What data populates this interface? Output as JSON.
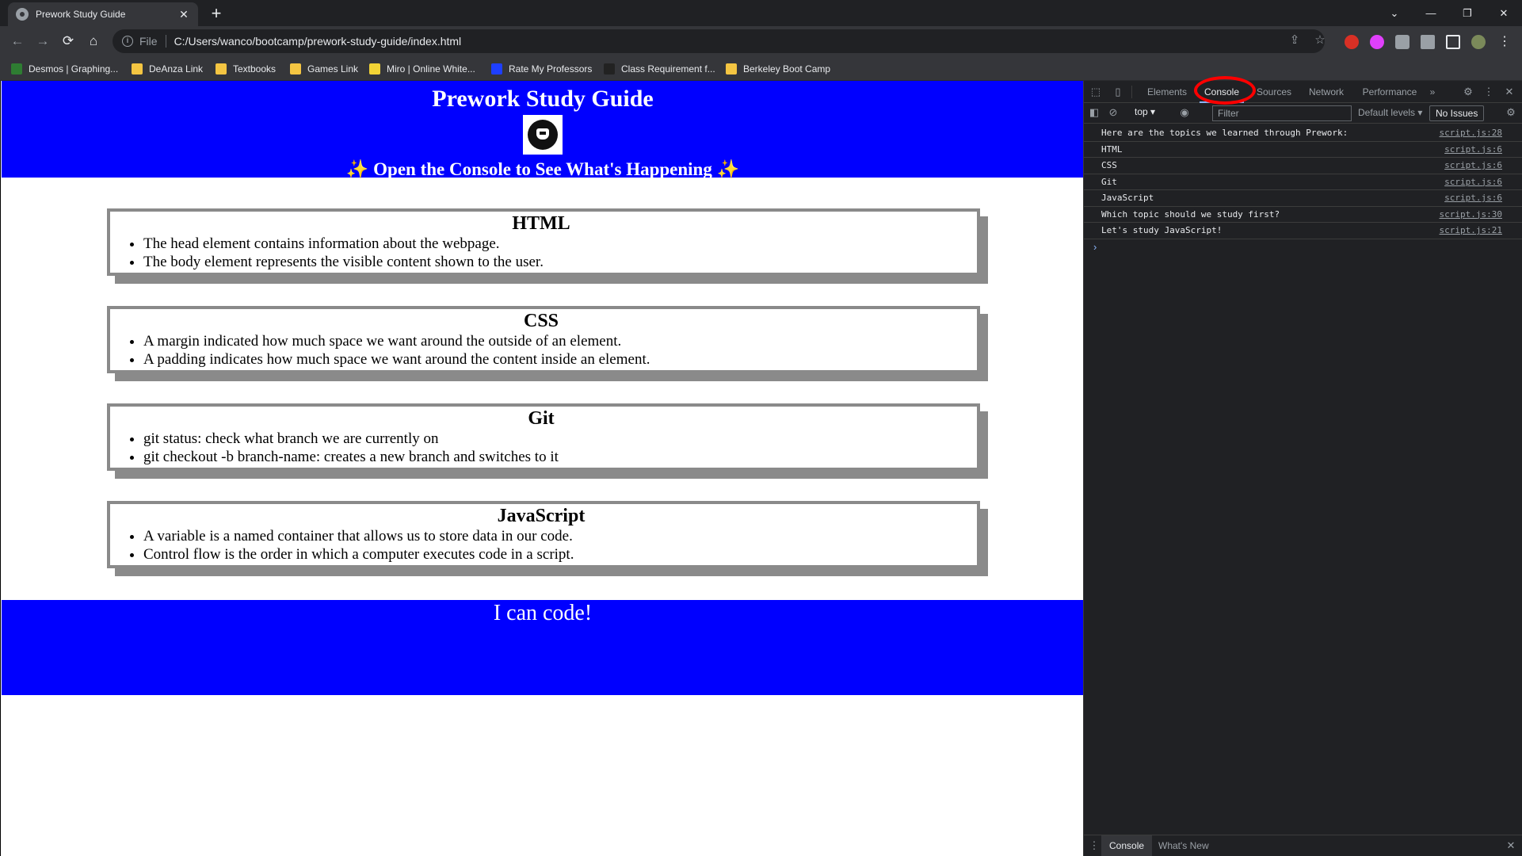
{
  "browser": {
    "tab_title": "Prework Study Guide",
    "tab_close": "✕",
    "new_tab": "+",
    "url_scheme": "File",
    "url": "C:/Users/wanco/bootcamp/prework-study-guide/index.html",
    "window_controls": [
      "⌄",
      "—",
      "❐",
      "✕"
    ],
    "bookmarks": [
      {
        "label": "Desmos | Graphing...",
        "color": "#2e7d32"
      },
      {
        "label": "DeAnza Link",
        "color": "#f4c542"
      },
      {
        "label": "Textbooks",
        "color": "#f4c542"
      },
      {
        "label": "Games Link",
        "color": "#f4c542"
      },
      {
        "label": "Miro | Online White...",
        "color": "#f2d335"
      },
      {
        "label": "Rate My Professors",
        "color": "#1e3fff"
      },
      {
        "label": "Class Requirement f...",
        "color": "#222222"
      },
      {
        "label": "Berkeley Boot Camp",
        "color": "#f4c542"
      }
    ]
  },
  "page": {
    "title": "Prework Study Guide",
    "subtitle": "✨ Open the Console to See What's Happening ✨",
    "sections": [
      {
        "heading": "HTML",
        "items": [
          "The head element contains information about the webpage.",
          "The body element represents the visible content shown to the user."
        ]
      },
      {
        "heading": "CSS",
        "items": [
          "A margin indicated how much space we want around the outside of an element.",
          "A padding indicates how much space we want around the content inside an element."
        ]
      },
      {
        "heading": "Git",
        "items": [
          "git status: check what branch we are currently on",
          "git checkout -b branch-name: creates a new branch and switches to it"
        ]
      },
      {
        "heading": "JavaScript",
        "items": [
          "A variable is a named container that allows us to store data in our code.",
          "Control flow is the order in which a computer executes code in a script."
        ]
      }
    ],
    "footer": "I can code!",
    "colors": {
      "accent": "#0000ff",
      "card_border": "#8a8a8a"
    }
  },
  "devtools": {
    "tabs": [
      "Elements",
      "Console",
      "Sources",
      "Network",
      "Performance"
    ],
    "active_tab": "Console",
    "more_tabs": "»",
    "context": "top",
    "filter_placeholder": "Filter",
    "levels": "Default levels ▾",
    "issues": "No Issues",
    "logs": [
      {
        "msg": "Here are the topics we learned through Prework:",
        "src": "script.js:28"
      },
      {
        "msg": "HTML",
        "src": "script.js:6"
      },
      {
        "msg": "CSS",
        "src": "script.js:6"
      },
      {
        "msg": "Git",
        "src": "script.js:6"
      },
      {
        "msg": "JavaScript",
        "src": "script.js:6"
      },
      {
        "msg": "Which topic should we study first?",
        "src": "script.js:30"
      },
      {
        "msg": "Let's study JavaScript!",
        "src": "script.js:21"
      }
    ],
    "prompt": "›",
    "drawer_tabs": [
      "Console",
      "What's New"
    ],
    "drawer_close": "✕"
  }
}
